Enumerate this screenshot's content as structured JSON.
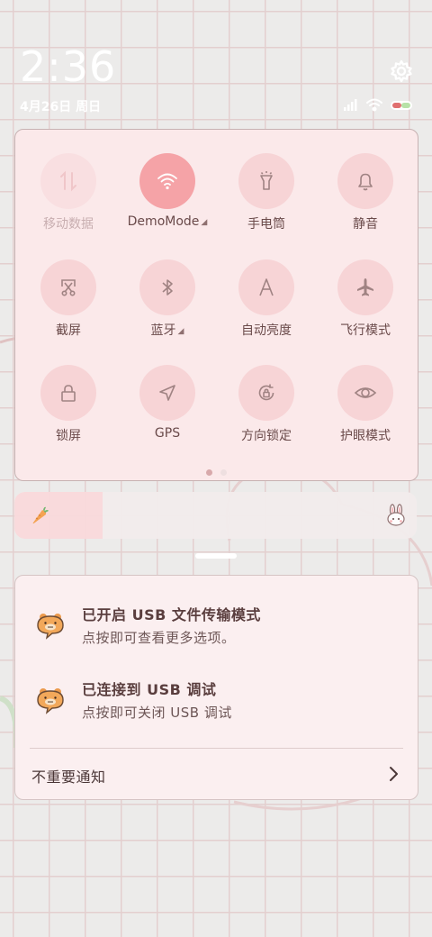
{
  "status_bar": {
    "time": "2:36",
    "date": "4月26日 周日"
  },
  "quick_settings": {
    "tiles": [
      {
        "label": "移动数据",
        "state": "disabled",
        "icon": "mobile-data-icon",
        "dropdown": false
      },
      {
        "label": "DemoMode",
        "state": "on",
        "icon": "wifi-icon",
        "dropdown": true
      },
      {
        "label": "手电筒",
        "state": "off",
        "icon": "flashlight-icon",
        "dropdown": false
      },
      {
        "label": "静音",
        "state": "off",
        "icon": "bell-icon",
        "dropdown": false
      },
      {
        "label": "截屏",
        "state": "off",
        "icon": "screenshot-icon",
        "dropdown": false
      },
      {
        "label": "蓝牙",
        "state": "off",
        "icon": "bluetooth-icon",
        "dropdown": true
      },
      {
        "label": "自动亮度",
        "state": "off",
        "icon": "auto-brightness-icon",
        "dropdown": false
      },
      {
        "label": "飞行模式",
        "state": "off",
        "icon": "airplane-icon",
        "dropdown": false
      },
      {
        "label": "锁屏",
        "state": "off",
        "icon": "lock-icon",
        "dropdown": false
      },
      {
        "label": "GPS",
        "state": "off",
        "icon": "location-arrow-icon",
        "dropdown": false
      },
      {
        "label": "方向锁定",
        "state": "off",
        "icon": "rotation-lock-icon",
        "dropdown": false
      },
      {
        "label": "护眼模式",
        "state": "off",
        "icon": "eye-icon",
        "dropdown": false
      }
    ],
    "page_count": 2,
    "current_page": 1
  },
  "brightness": {
    "level": 0.22
  },
  "notifications": [
    {
      "title": "已开启 USB 文件传输模式",
      "body": "点按即可查看更多选项。",
      "icon": "bear-app-icon"
    },
    {
      "title": "已连接到 USB 调试",
      "body": "点按即可关闭 USB 调试",
      "icon": "bear-app-icon"
    }
  ],
  "minor_notifications": {
    "label": "不重要通知"
  },
  "colors": {
    "accent": "#f5a3a7",
    "tile_bg": "#f7d4d6",
    "panel_bg": "#fbe9ea",
    "text": "#6a4a4a"
  }
}
